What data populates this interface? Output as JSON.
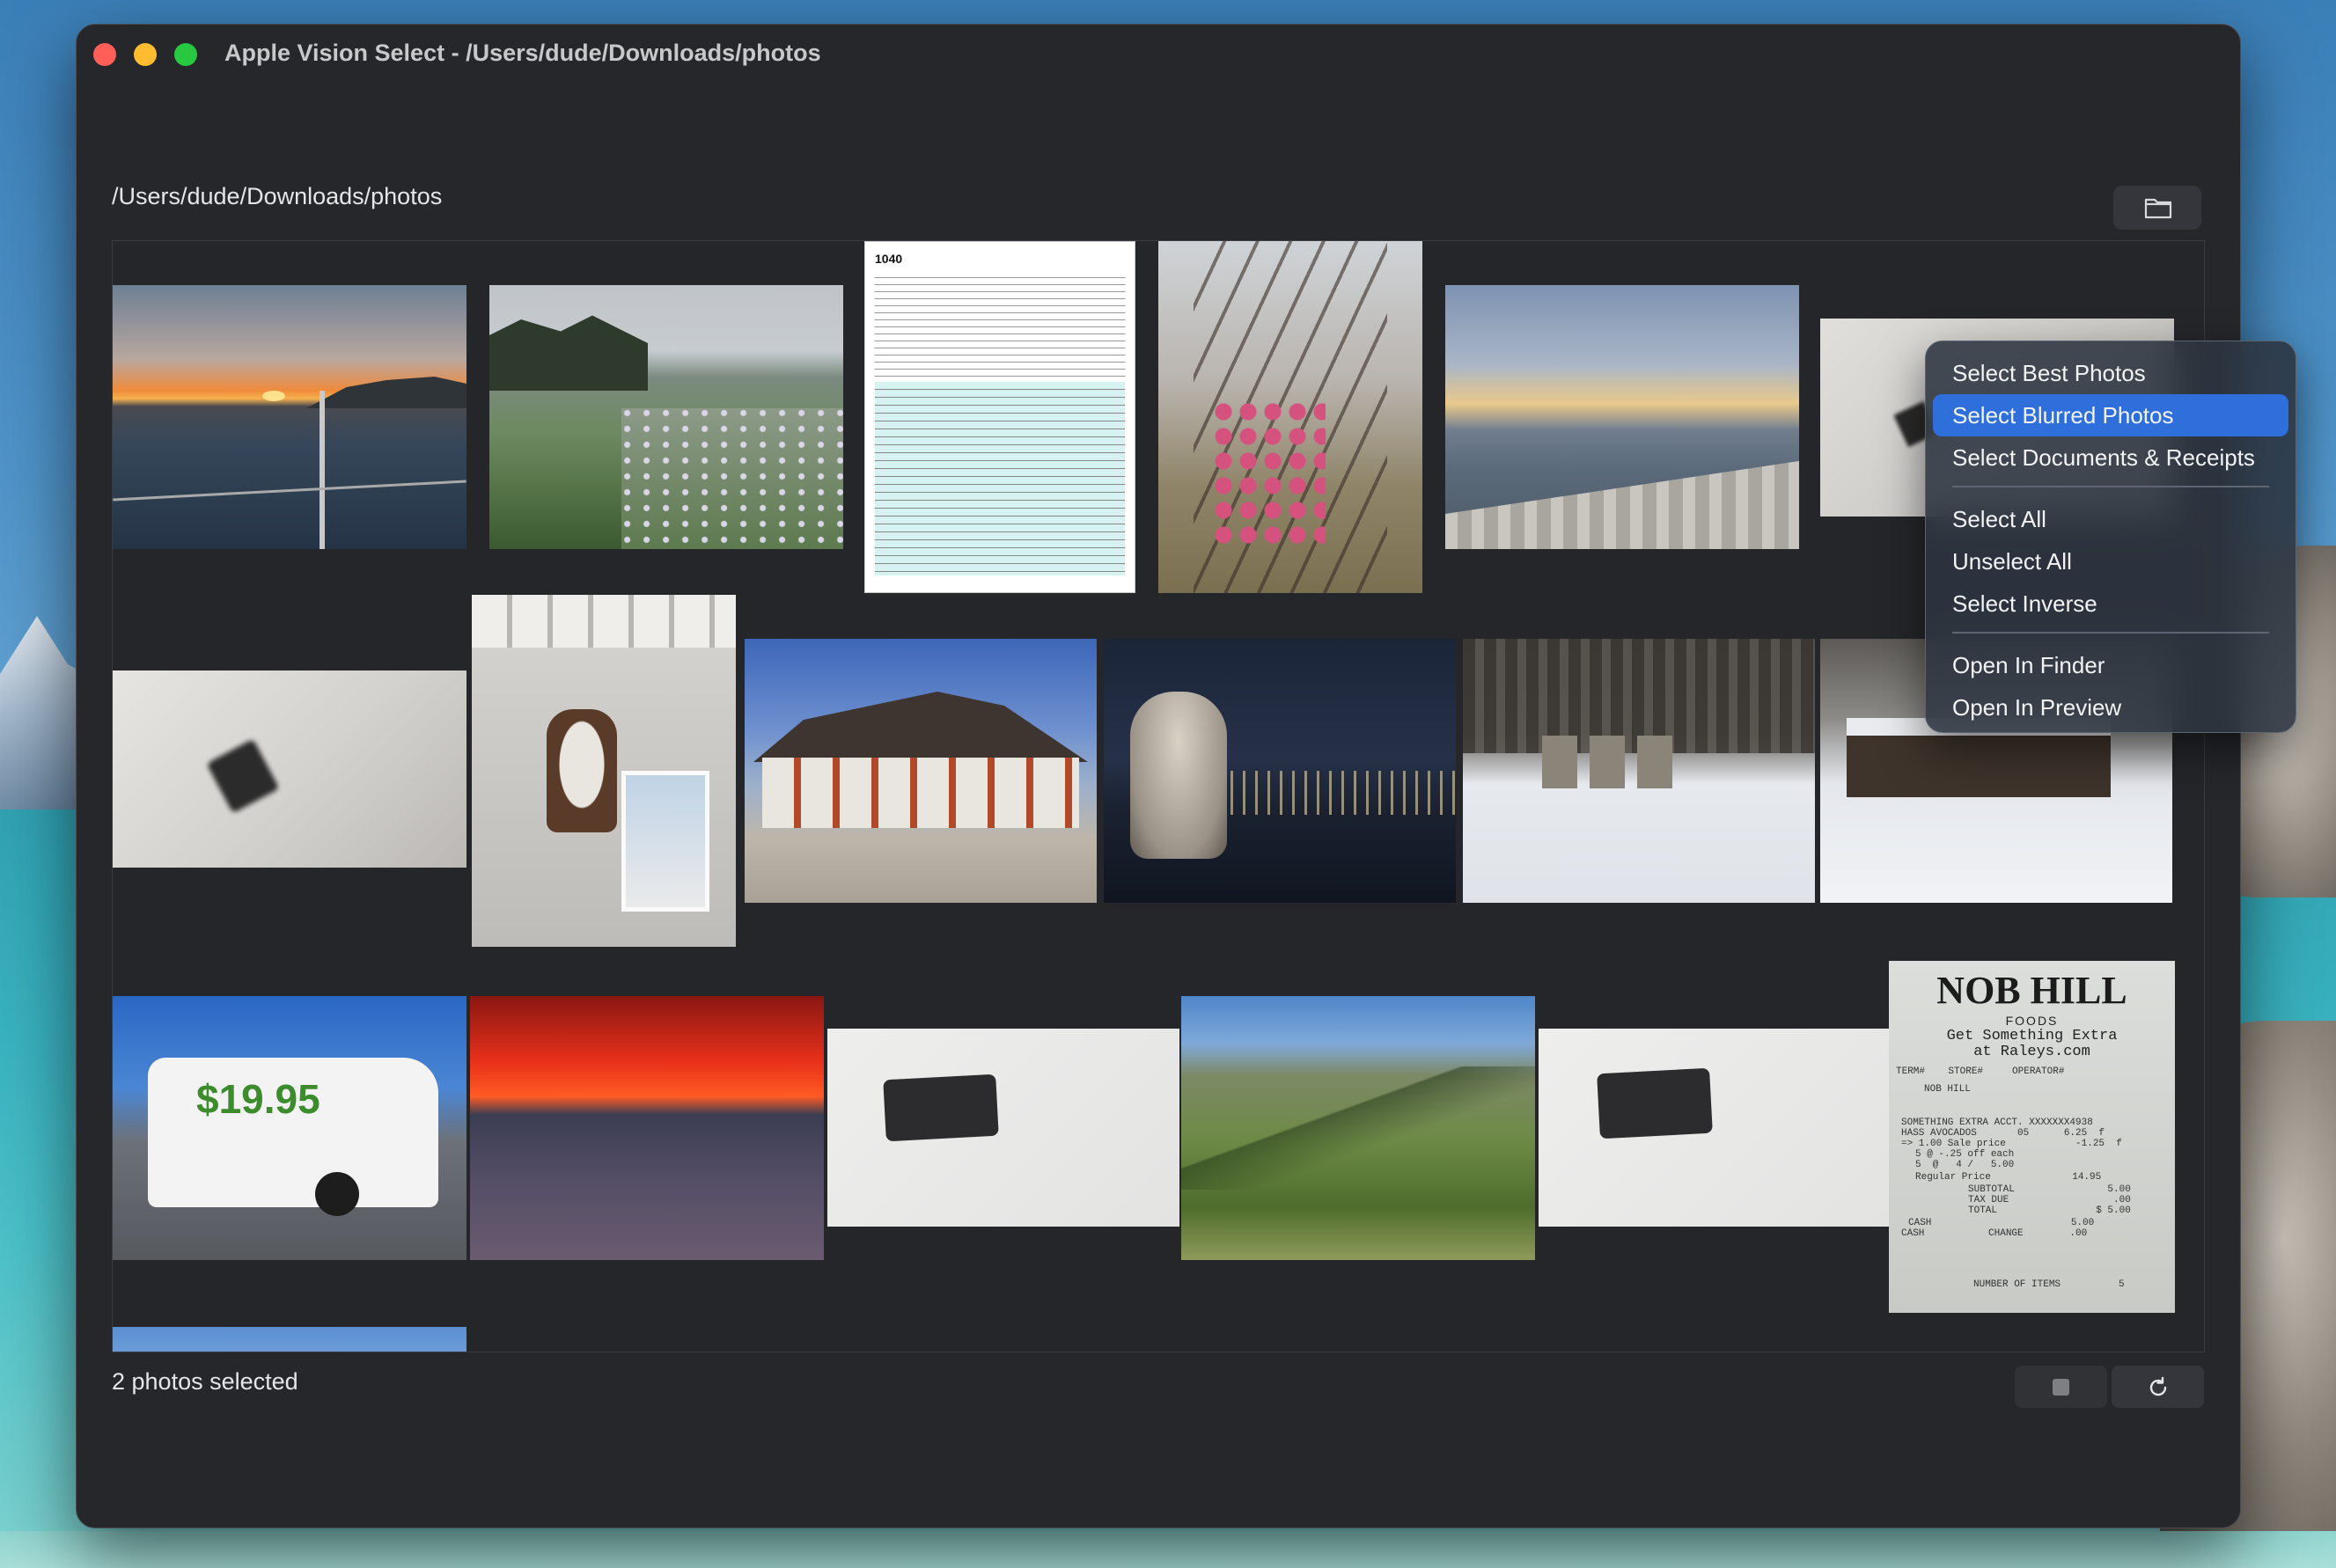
{
  "window": {
    "title": "Apple Vision Select - /Users/dude/Downloads/photos",
    "path": "/Users/dude/Downloads/photos"
  },
  "photos": [
    {
      "description": "sunset-over-sea",
      "selected": false
    },
    {
      "description": "coastal-wildflowers",
      "selected": false
    },
    {
      "description": "tax-form-1040",
      "selected": false
    },
    {
      "description": "plum-blossoms",
      "selected": false
    },
    {
      "description": "sunrise-balcony",
      "selected": false
    },
    {
      "description": "blurred-wall-outlet",
      "selected": true
    },
    {
      "description": "blurred-wall-outlet",
      "selected": true
    },
    {
      "description": "hanging-lantern",
      "selected": false
    },
    {
      "description": "japanese-temple",
      "selected": false
    },
    {
      "description": "merlion-night",
      "selected": false
    },
    {
      "description": "snowy-cabins",
      "selected": false
    },
    {
      "description": "snowy-lodge",
      "selected": false
    },
    {
      "description": "moving-van",
      "selected": false
    },
    {
      "description": "red-sunset-sea",
      "selected": false
    },
    {
      "description": "wall-outlet",
      "selected": false
    },
    {
      "description": "green-hills",
      "selected": false
    },
    {
      "description": "wall-outlet",
      "selected": false
    },
    {
      "description": "grocery-receipt",
      "selected": false
    },
    {
      "description": "sky",
      "selected": false
    }
  ],
  "receipt": {
    "store": "NOB HILL",
    "sub": "FOODS",
    "promo1": "Get Something Extra",
    "promo2": "at Raleys.com",
    "line1": "TERM#    STORE#     OPERATOR#",
    "line2": "NOB HILL",
    "line3": "SOMETHING EXTRA ACCT. XXXXXXX4938",
    "line4": "HASS AVOCADOS       05      6.25  f",
    "line5": "=> 1.00 Sale price            -1.25  f",
    "line6": "5 @ -.25 off each",
    "line7": "5  @   4 /   5.00",
    "line8": "Regular Price              14.95",
    "line9": "SUBTOTAL                5.00",
    "line10": "TAX DUE                  .00",
    "line11": "TOTAL                 $ 5.00",
    "line12": "CASH                        5.00",
    "line13": "CASH           CHANGE        .00",
    "line14": "NUMBER OF ITEMS          5"
  },
  "van": {
    "price": "$19.95"
  },
  "status": {
    "text": "2 photos selected"
  },
  "menu": {
    "items": [
      "Select Best Photos",
      "Select Blurred Photos",
      "Select Documents & Receipts",
      "Select All",
      "Unselect All",
      "Select Inverse",
      "Open In Finder",
      "Open In Preview"
    ],
    "highlighted_index": 1
  },
  "colors": {
    "selection_border": "#d6f27a",
    "menu_highlight": "#2f6fdb",
    "window_bg": "#25272b"
  }
}
